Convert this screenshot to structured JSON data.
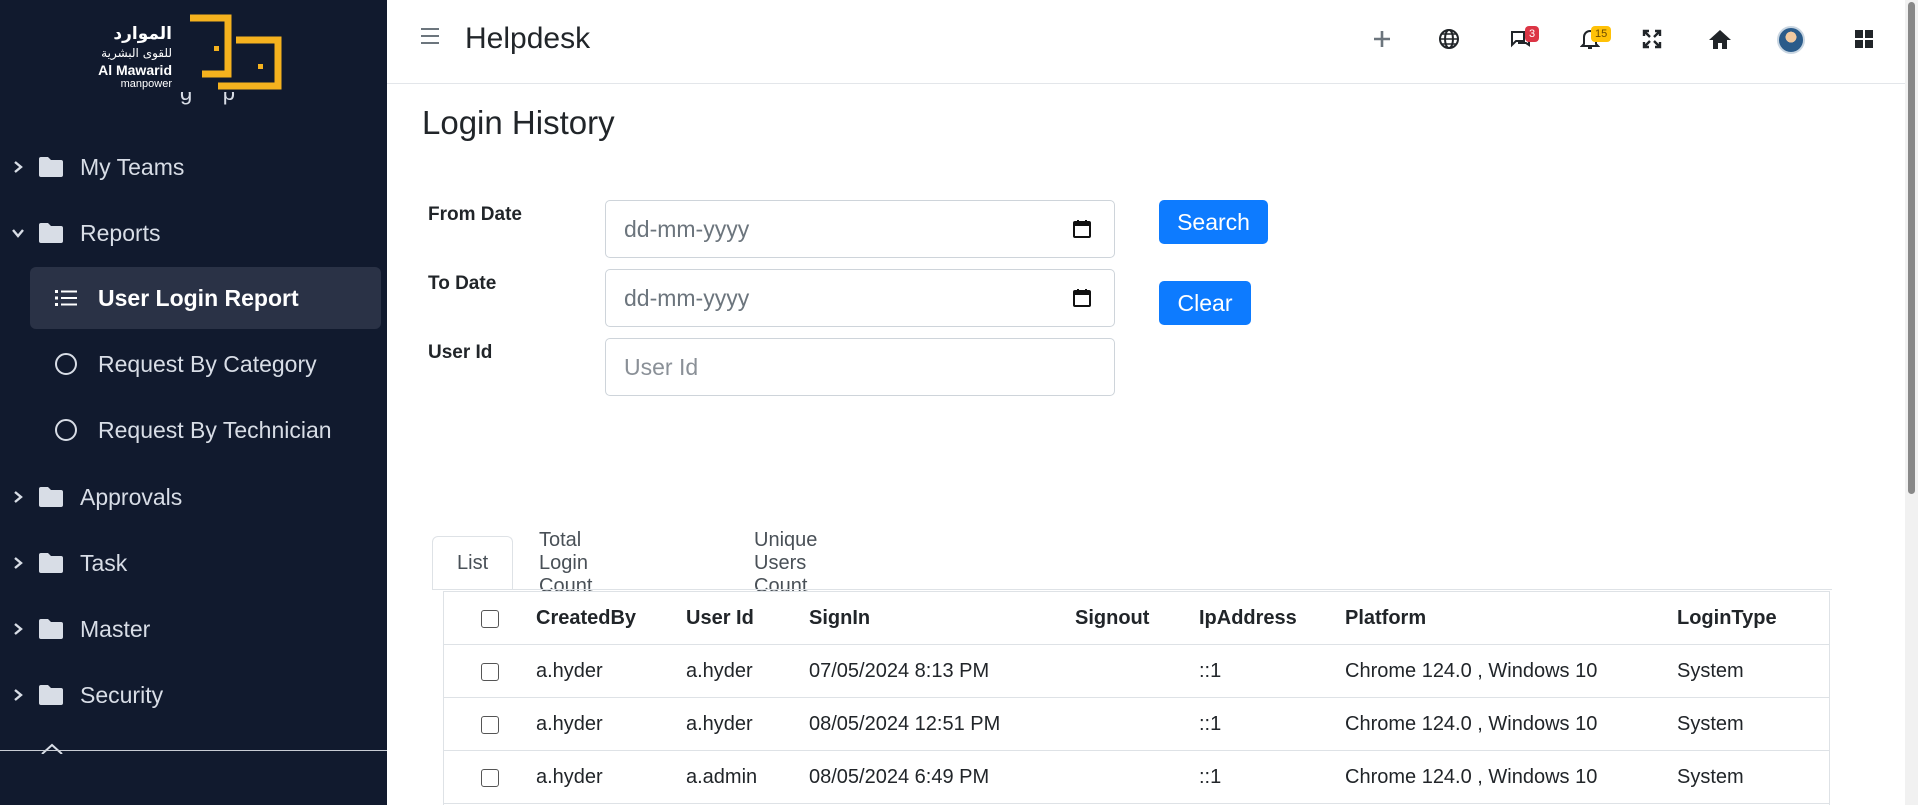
{
  "logo": {
    "arabic_line1": "الموارد",
    "arabic_line2": "للقوى البشرية",
    "english_line1": "Al Mawarid",
    "english_line2": "manpower",
    "brand_color": "#f5b21e"
  },
  "sidebar": {
    "items": [
      {
        "label": "My Teams",
        "icon": "folder-icon",
        "chevron": "chevron-right-icon"
      },
      {
        "label": "Reports",
        "icon": "folder-icon",
        "chevron": "chevron-down-icon"
      },
      {
        "label": "Approvals",
        "icon": "folder-icon",
        "chevron": "chevron-right-icon"
      },
      {
        "label": "Task",
        "icon": "folder-icon",
        "chevron": "chevron-right-icon"
      },
      {
        "label": "Master",
        "icon": "folder-icon",
        "chevron": "chevron-right-icon"
      },
      {
        "label": "Security",
        "icon": "folder-icon",
        "chevron": "chevron-right-icon"
      }
    ],
    "report_subitems": [
      {
        "label": "User Login Report",
        "icon": "list-icon",
        "active": true
      },
      {
        "label": "Request By Category",
        "icon": "circle-icon",
        "active": false
      },
      {
        "label": "Request By Technician",
        "icon": "circle-icon",
        "active": false
      }
    ],
    "background": "#111a2e"
  },
  "header": {
    "title": "Helpdesk",
    "icons": [
      "menu-icon",
      "plus-icon",
      "globe-icon",
      "chat-icon",
      "bell-icon",
      "fullscreen-icon",
      "home-icon",
      "avatar",
      "grid-icon"
    ],
    "chat_badge": "3",
    "notification_badge": "15"
  },
  "main": {
    "page_title": "Login History",
    "filters": {
      "from_date_label": "From Date",
      "from_date_placeholder": "dd-mm-yyyy",
      "to_date_label": "To Date",
      "to_date_placeholder": "dd-mm-yyyy",
      "user_id_label": "User Id",
      "user_id_placeholder": "User Id"
    },
    "buttons": {
      "search": "Search",
      "clear": "Clear"
    },
    "accent_color": "#0d7bff",
    "tabs": [
      {
        "label": "List",
        "active": true
      },
      {
        "label": "Total Login Count",
        "active": false
      },
      {
        "label": "Unique Users Count",
        "active": false
      }
    ],
    "table": {
      "columns": [
        "CreatedBy",
        "User Id",
        "SignIn",
        "Signout",
        "IpAddress",
        "Platform",
        "LoginType"
      ],
      "rows": [
        [
          "a.hyder",
          "a.hyder",
          "07/05/2024 8:13 PM",
          "",
          "::1",
          "Chrome 124.0 , Windows 10",
          "System"
        ],
        [
          "a.hyder",
          "a.hyder",
          "08/05/2024 12:51 PM",
          "",
          "::1",
          "Chrome 124.0 , Windows 10",
          "System"
        ],
        [
          "a.hyder",
          "a.admin",
          "08/05/2024 6:49 PM",
          "",
          "::1",
          "Chrome 124.0 , Windows 10",
          "System"
        ]
      ]
    }
  }
}
